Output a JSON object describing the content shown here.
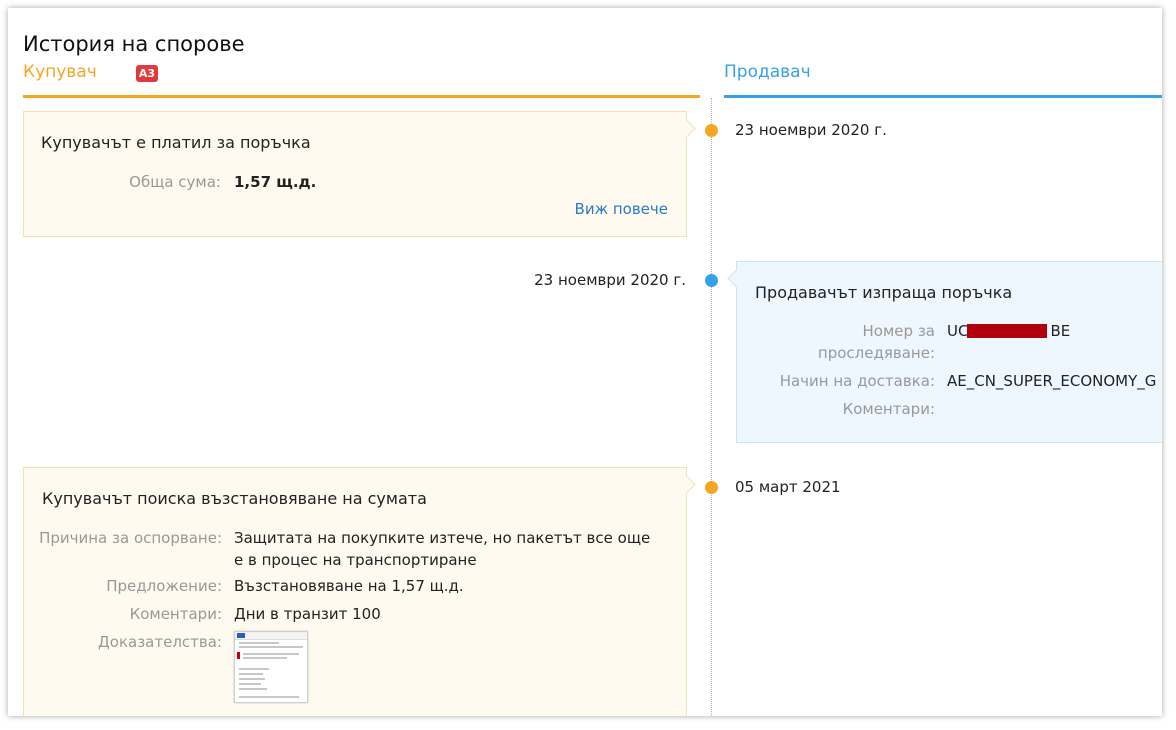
{
  "page": {
    "title": "История на спорове",
    "buyer_label": "Купувач",
    "buyer_badge": "A3",
    "seller_label": "Продавач"
  },
  "colors": {
    "buyer_accent": "#f5a623",
    "seller_accent": "#36a1e6",
    "badge": "#e4393c",
    "link": "#2a7ac2"
  },
  "events": [
    {
      "side": "buyer",
      "date": "23 ноември 2020 г.",
      "title": "Купувачът е платил за поръчка",
      "fields": [
        {
          "label": "Обща сума:",
          "value": "1,57 щ.д."
        }
      ],
      "link": "Виж повече"
    },
    {
      "side": "seller",
      "date": "23 ноември 2020 г.",
      "title": "Продавачът изпраща поръчка",
      "fields": [
        {
          "label": "Номер за проследяване:",
          "value_prefix": "UC",
          "value_suffix": "BE"
        },
        {
          "label": "Начин на доставка:",
          "value": "AE_CN_SUPER_ECONOMY_G"
        },
        {
          "label": "Коментари:",
          "value": ""
        }
      ]
    },
    {
      "side": "buyer",
      "date": "05 март 2021",
      "title": "Купувачът поиска възстановяване на сумата",
      "fields": [
        {
          "label": "Причина за оспорване:",
          "value": "Защитата на покупките изтече, но пакетът все още е в процес на транспортиране"
        },
        {
          "label": "Предложение:",
          "value": "Възстановяване на 1,57 щ.д."
        },
        {
          "label": "Коментари:",
          "value": "Дни в транзит 100"
        },
        {
          "label": "Доказателства:",
          "value": ""
        }
      ]
    }
  ]
}
